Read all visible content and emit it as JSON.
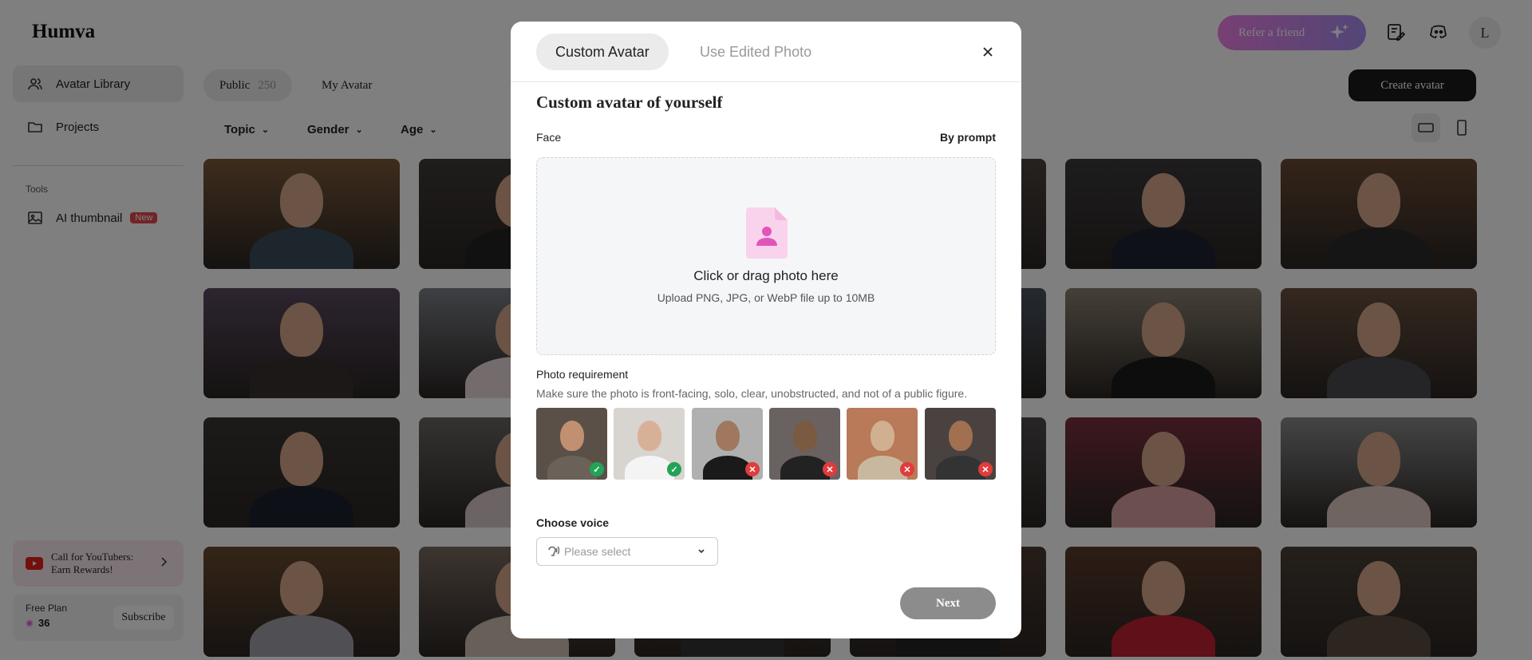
{
  "app": {
    "logo": "Humva"
  },
  "sidebar": {
    "items": [
      {
        "label": "Avatar Library"
      },
      {
        "label": "Projects"
      }
    ],
    "tools_title": "Tools",
    "tools": [
      {
        "label": "AI thumbnail",
        "badge": "New"
      }
    ],
    "promo": {
      "line1": "Call for YouTubers:",
      "line2": "Earn Rewards!"
    },
    "plan": {
      "label": "Free Plan",
      "credits": "36",
      "subscribe": "Subscribe"
    }
  },
  "header": {
    "refer": "Refer a friend",
    "user_initial": "L"
  },
  "library": {
    "tabs": [
      {
        "label": "Public",
        "count": "250"
      },
      {
        "label": "My Avatar"
      }
    ],
    "create": "Create avatar",
    "filters": [
      "Topic",
      "Gender",
      "Age"
    ]
  },
  "modal": {
    "tabs": [
      "Custom Avatar",
      "Use Edited Photo"
    ],
    "title": "Custom avatar of yourself",
    "face_label": "Face",
    "by_prompt": "By prompt",
    "dropzone_title": "Click or drag photo here",
    "dropzone_sub": "Upload PNG, JPG, or WebP file up to 10MB",
    "req_title": "Photo requirement",
    "req_sub": "Make sure the photo is front-facing, solo, clear, unobstructed, and not of a public figure.",
    "samples": [
      "ok",
      "ok",
      "bad",
      "bad",
      "bad",
      "bad"
    ],
    "voice_label": "Choose voice",
    "voice_placeholder": "Please select",
    "next": "Next"
  },
  "colors": {
    "accent_refer_start": "#f080e6",
    "accent_refer_end": "#a68cf0",
    "ok": "#22a355",
    "bad": "#e03c3c",
    "dark_button": "#1b1b1b"
  }
}
